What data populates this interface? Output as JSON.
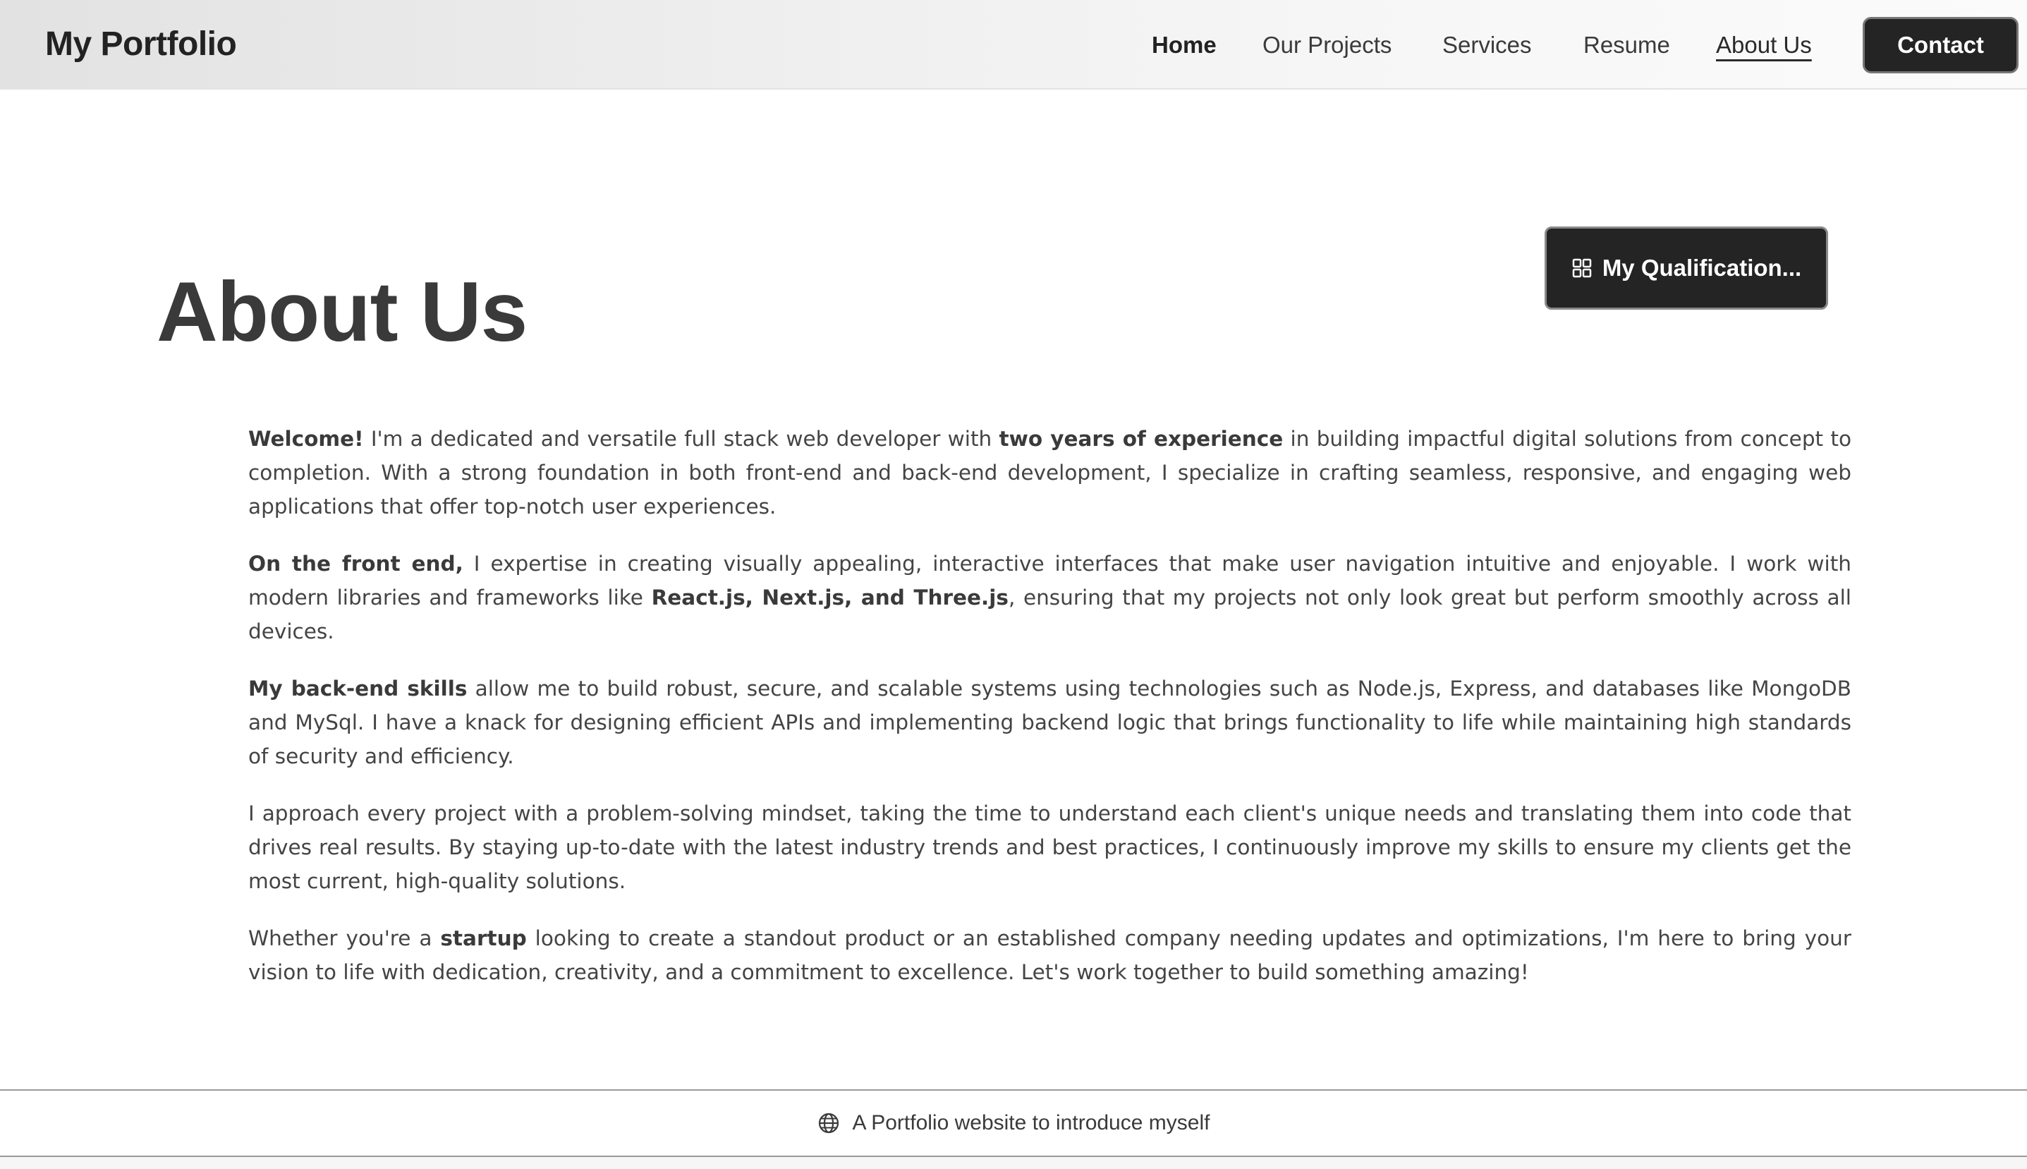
{
  "header": {
    "brand": "My Portfolio",
    "nav": [
      {
        "label": "Home",
        "state": "active"
      },
      {
        "label": "Our Projects",
        "state": ""
      },
      {
        "label": "Services",
        "state": ""
      },
      {
        "label": "Resume",
        "state": ""
      },
      {
        "label": "About Us",
        "state": "current"
      }
    ],
    "contact_label": "Contact"
  },
  "main": {
    "title": "About Us",
    "qualification_label": "My Qualification...",
    "qualification_icon": "grid-icon",
    "paragraphs": [
      [
        {
          "text": "Welcome!",
          "bold": true
        },
        {
          "text": " I'm a dedicated and versatile full stack web developer with ",
          "bold": false
        },
        {
          "text": "two years of experience",
          "bold": true
        },
        {
          "text": " in building impactful digital solutions from concept to completion. With a strong foundation in both front-end and back-end development, I specialize in crafting seamless, responsive, and engaging web applications that offer top-notch user experiences.",
          "bold": false
        }
      ],
      [
        {
          "text": "On the front end,",
          "bold": true
        },
        {
          "text": " I expertise in creating visually appealing, interactive interfaces that make user navigation intuitive and enjoyable. I work with modern libraries and frameworks like ",
          "bold": false
        },
        {
          "text": "React.js, Next.js, and Three.js",
          "bold": true
        },
        {
          "text": ", ensuring that my projects not only look great but perform smoothly across all devices.",
          "bold": false
        }
      ],
      [
        {
          "text": "My back-end skills",
          "bold": true
        },
        {
          "text": " allow me to build robust, secure, and scalable systems using technologies such as Node.js, Express, and databases like MongoDB and MySql. I have a knack for designing efficient APIs and implementing backend logic that brings functionality to life while maintaining high standards of security and efficiency.",
          "bold": false
        }
      ],
      [
        {
          "text": "I approach every project with a problem-solving mindset, taking the time to understand each client's unique needs and translating them into code that drives real results. By staying up-to-date with the latest industry trends and best practices, I continuously improve my skills to ensure my clients get the most current, high-quality solutions.",
          "bold": false
        }
      ],
      [
        {
          "text": "Whether you're a ",
          "bold": false
        },
        {
          "text": "startup",
          "bold": true
        },
        {
          "text": " looking to create a standout product or an established company needing updates and optimizations, I'm here to bring your vision to life with dedication, creativity, and a commitment to excellence. Let's work together to build something amazing!",
          "bold": false
        }
      ]
    ]
  },
  "footer": {
    "icon": "globe-icon",
    "text": "A Portfolio website to introduce myself"
  }
}
